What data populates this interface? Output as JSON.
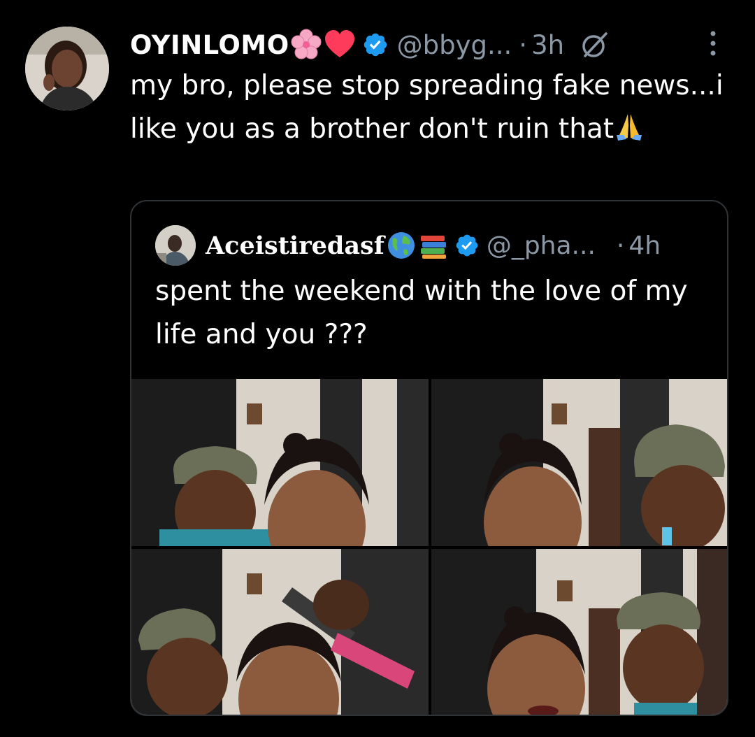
{
  "tweet": {
    "display_name": "OYINLOMO",
    "name_emojis": [
      "cherry-blossom-emoji",
      "red-heart-emoji"
    ],
    "handle": "@bbyg...",
    "dot": "·",
    "time": "3h",
    "text": "my bro, please stop spreading fake news...i like you as a brother don't ruin that",
    "text_emoji": "folded-hands-emoji"
  },
  "quoted_tweet": {
    "display_name": "Aceistiredasf",
    "name_emojis": [
      "globe-emoji",
      "books-emoji"
    ],
    "handle": "@_pha...",
    "dot": "·",
    "time": "4h",
    "text": "spent the weekend with the love of my life and you ???",
    "media_count": 4
  },
  "icons": {
    "verified": "verified-badge-icon",
    "grok": "grok-icon",
    "more": "more-options-icon"
  },
  "colors": {
    "background": "#000000",
    "text_primary": "#ffffff",
    "text_secondary": "#8b98a5",
    "verified_blue": "#1d9bf0",
    "border": "#2f3336"
  }
}
